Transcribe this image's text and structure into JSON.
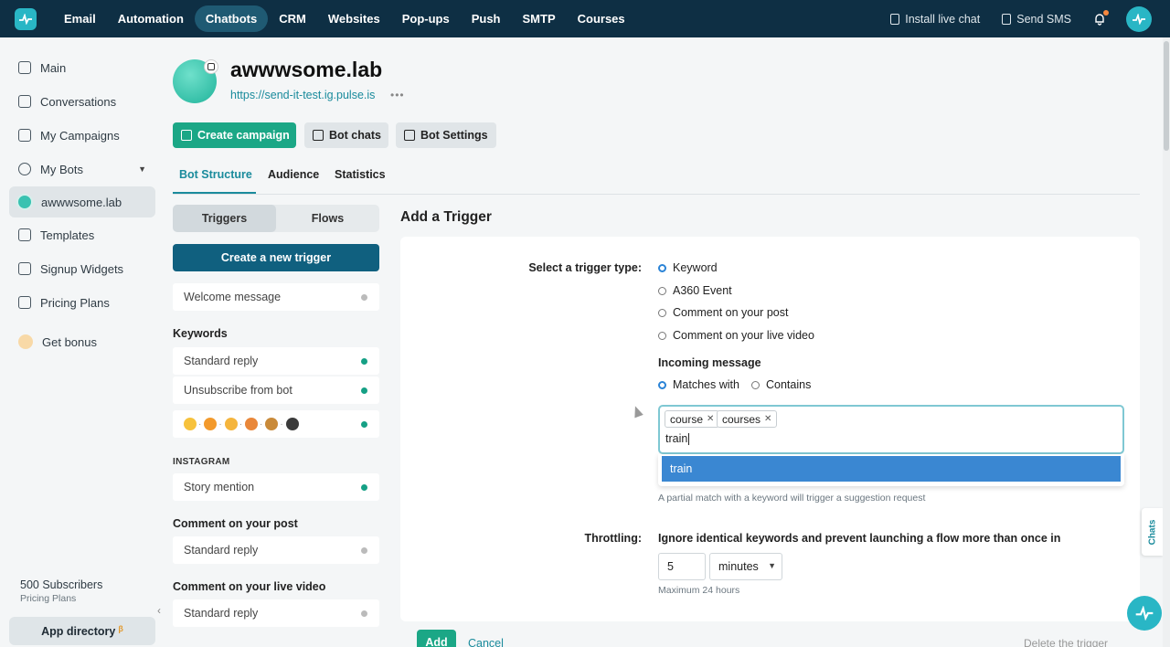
{
  "topbar": {
    "nav": [
      "Email",
      "Automation",
      "Chatbots",
      "CRM",
      "Websites",
      "Pop-ups",
      "Push",
      "SMTP",
      "Courses"
    ],
    "active_nav": "Chatbots",
    "install_live_chat": "Install live chat",
    "send_sms": "Send SMS",
    "notification_accent": "#f5883f"
  },
  "sidebar": {
    "items": [
      "Main",
      "Conversations",
      "My Campaigns",
      "My Bots",
      "awwwsome.lab",
      "Templates",
      "Signup Widgets",
      "Pricing Plans",
      "Get bonus"
    ],
    "subscribers": "500 Subscribers",
    "pricing_plans": "Pricing Plans",
    "app_directory": "App directory",
    "beta_mark": "β"
  },
  "bot": {
    "name": "awwwsome.lab",
    "url": "https://send-it-test.ig.pulse.is",
    "more": "•••"
  },
  "actions": {
    "create_campaign": "Create campaign",
    "bot_chats": "Bot chats",
    "bot_settings": "Bot Settings"
  },
  "tabs": [
    "Bot Structure",
    "Audience",
    "Statistics"
  ],
  "active_tab": "Bot Structure",
  "triggers_panel": {
    "segments": [
      "Triggers",
      "Flows"
    ],
    "create_new": "Create a new trigger",
    "welcome": "Welcome message",
    "keywords_title": "Keywords",
    "keywords": [
      "Standard reply",
      "Unsubscribe from bot"
    ],
    "instagram_title": "INSTAGRAM",
    "story_mention": "Story mention",
    "comment_post_title": "Comment on your post",
    "comment_post_reply": "Standard reply",
    "comment_live_title": "Comment on your live video",
    "comment_live_reply": "Standard reply"
  },
  "add_trigger": {
    "title": "Add a Trigger",
    "select_type_label": "Select a trigger type:",
    "types": [
      "Keyword",
      "A360 Event",
      "Comment on your post",
      "Comment on your live video"
    ],
    "selected_type": "Keyword",
    "incoming_message": "Incoming message",
    "match_options": [
      "Matches with",
      "Contains"
    ],
    "selected_match": "Matches with",
    "tags": [
      "course",
      "courses"
    ],
    "typed_value": "train",
    "suggestion": "train",
    "hint": "A partial match with a keyword will trigger a suggestion request",
    "throttling_label": "Throttling:",
    "throttling_text": "Ignore identical keywords and prevent launching a flow more than once in",
    "throttle_value": "5",
    "throttle_unit": "minutes",
    "max_hint": "Maximum 24 hours",
    "add": "Add",
    "cancel": "Cancel",
    "delete": "Delete the trigger"
  },
  "chats_tab": "Chats",
  "colors": {
    "topbar": "#0e2f44",
    "primary_green": "#1ba786",
    "teal_link": "#1a8b9c",
    "dark_blue_button": "#10607f",
    "suggestion_blue": "#3a87d2"
  }
}
